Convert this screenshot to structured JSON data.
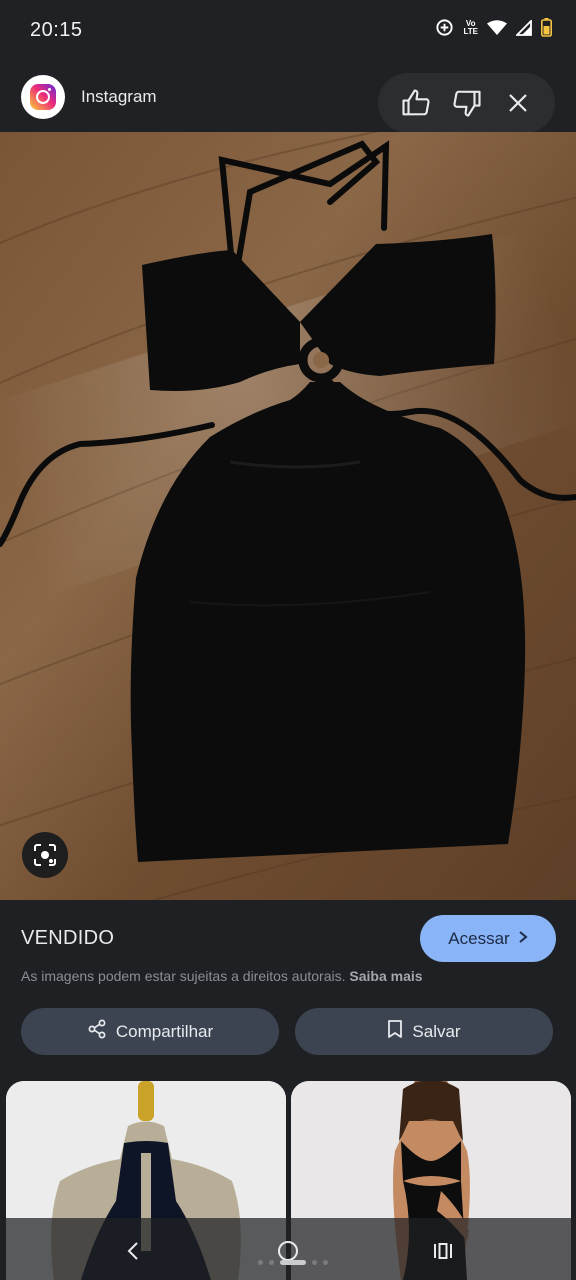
{
  "status_bar": {
    "time": "20:15",
    "volte_label": "Vo\nLTE",
    "icons": [
      "data-saver-icon",
      "volte-icon",
      "wifi-icon",
      "signal-icon",
      "battery-icon"
    ]
  },
  "source": {
    "name": "Instagram",
    "logo_icon": "instagram-logo",
    "actions": [
      "thumbs-up-icon",
      "thumbs-down-icon",
      "close-icon"
    ]
  },
  "result": {
    "title": "VENDIDO",
    "visit_label": "Acessar",
    "copyright_text": "As imagens podem estar sujeitas a direitos autorais.",
    "learn_more": "Saiba mais",
    "share_label": "Compartilhar",
    "save_label": "Salvar"
  },
  "colors": {
    "background": "#1f2024",
    "accent": "#8ab4f8",
    "pill_button": "#3c4452"
  },
  "nav": {
    "icons": [
      "back-icon",
      "home-icon",
      "recents-icon"
    ]
  }
}
